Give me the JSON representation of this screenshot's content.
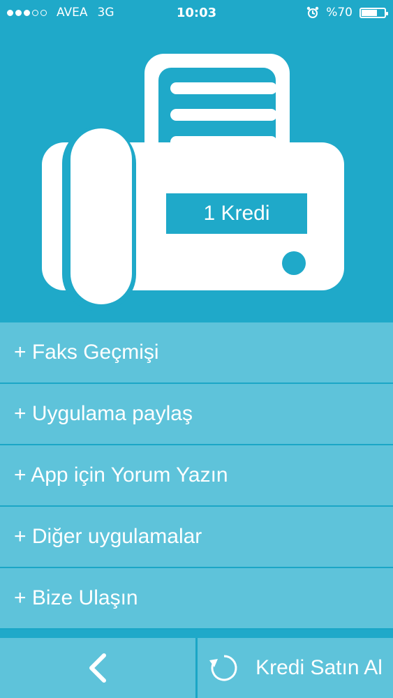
{
  "status_bar": {
    "carrier": "AVEA",
    "network": "3G",
    "time": "10:03",
    "battery_text": "%70",
    "battery_level": 0.7,
    "signal_bars_filled": 3,
    "signal_bars_total": 5
  },
  "hero": {
    "credits_label": "1 Kredi",
    "icon": "fax-machine-icon"
  },
  "menu": {
    "items": [
      {
        "label": "+ Faks Geçmişi"
      },
      {
        "label": "+ Uygulama paylaş"
      },
      {
        "label": "+ App için Yorum Yazın"
      },
      {
        "label": "+ Diğer uygulamalar"
      },
      {
        "label": "+ Bize Ulaşın"
      }
    ]
  },
  "bottom_bar": {
    "back_icon": "chevron-left-icon",
    "buy_icon": "refresh-icon",
    "buy_label": "Kredi Satın Al"
  },
  "colors": {
    "background": "#1fa9c9",
    "menu_item": "#5ec3da",
    "divider": "#1ba6c6",
    "text": "#ffffff"
  }
}
